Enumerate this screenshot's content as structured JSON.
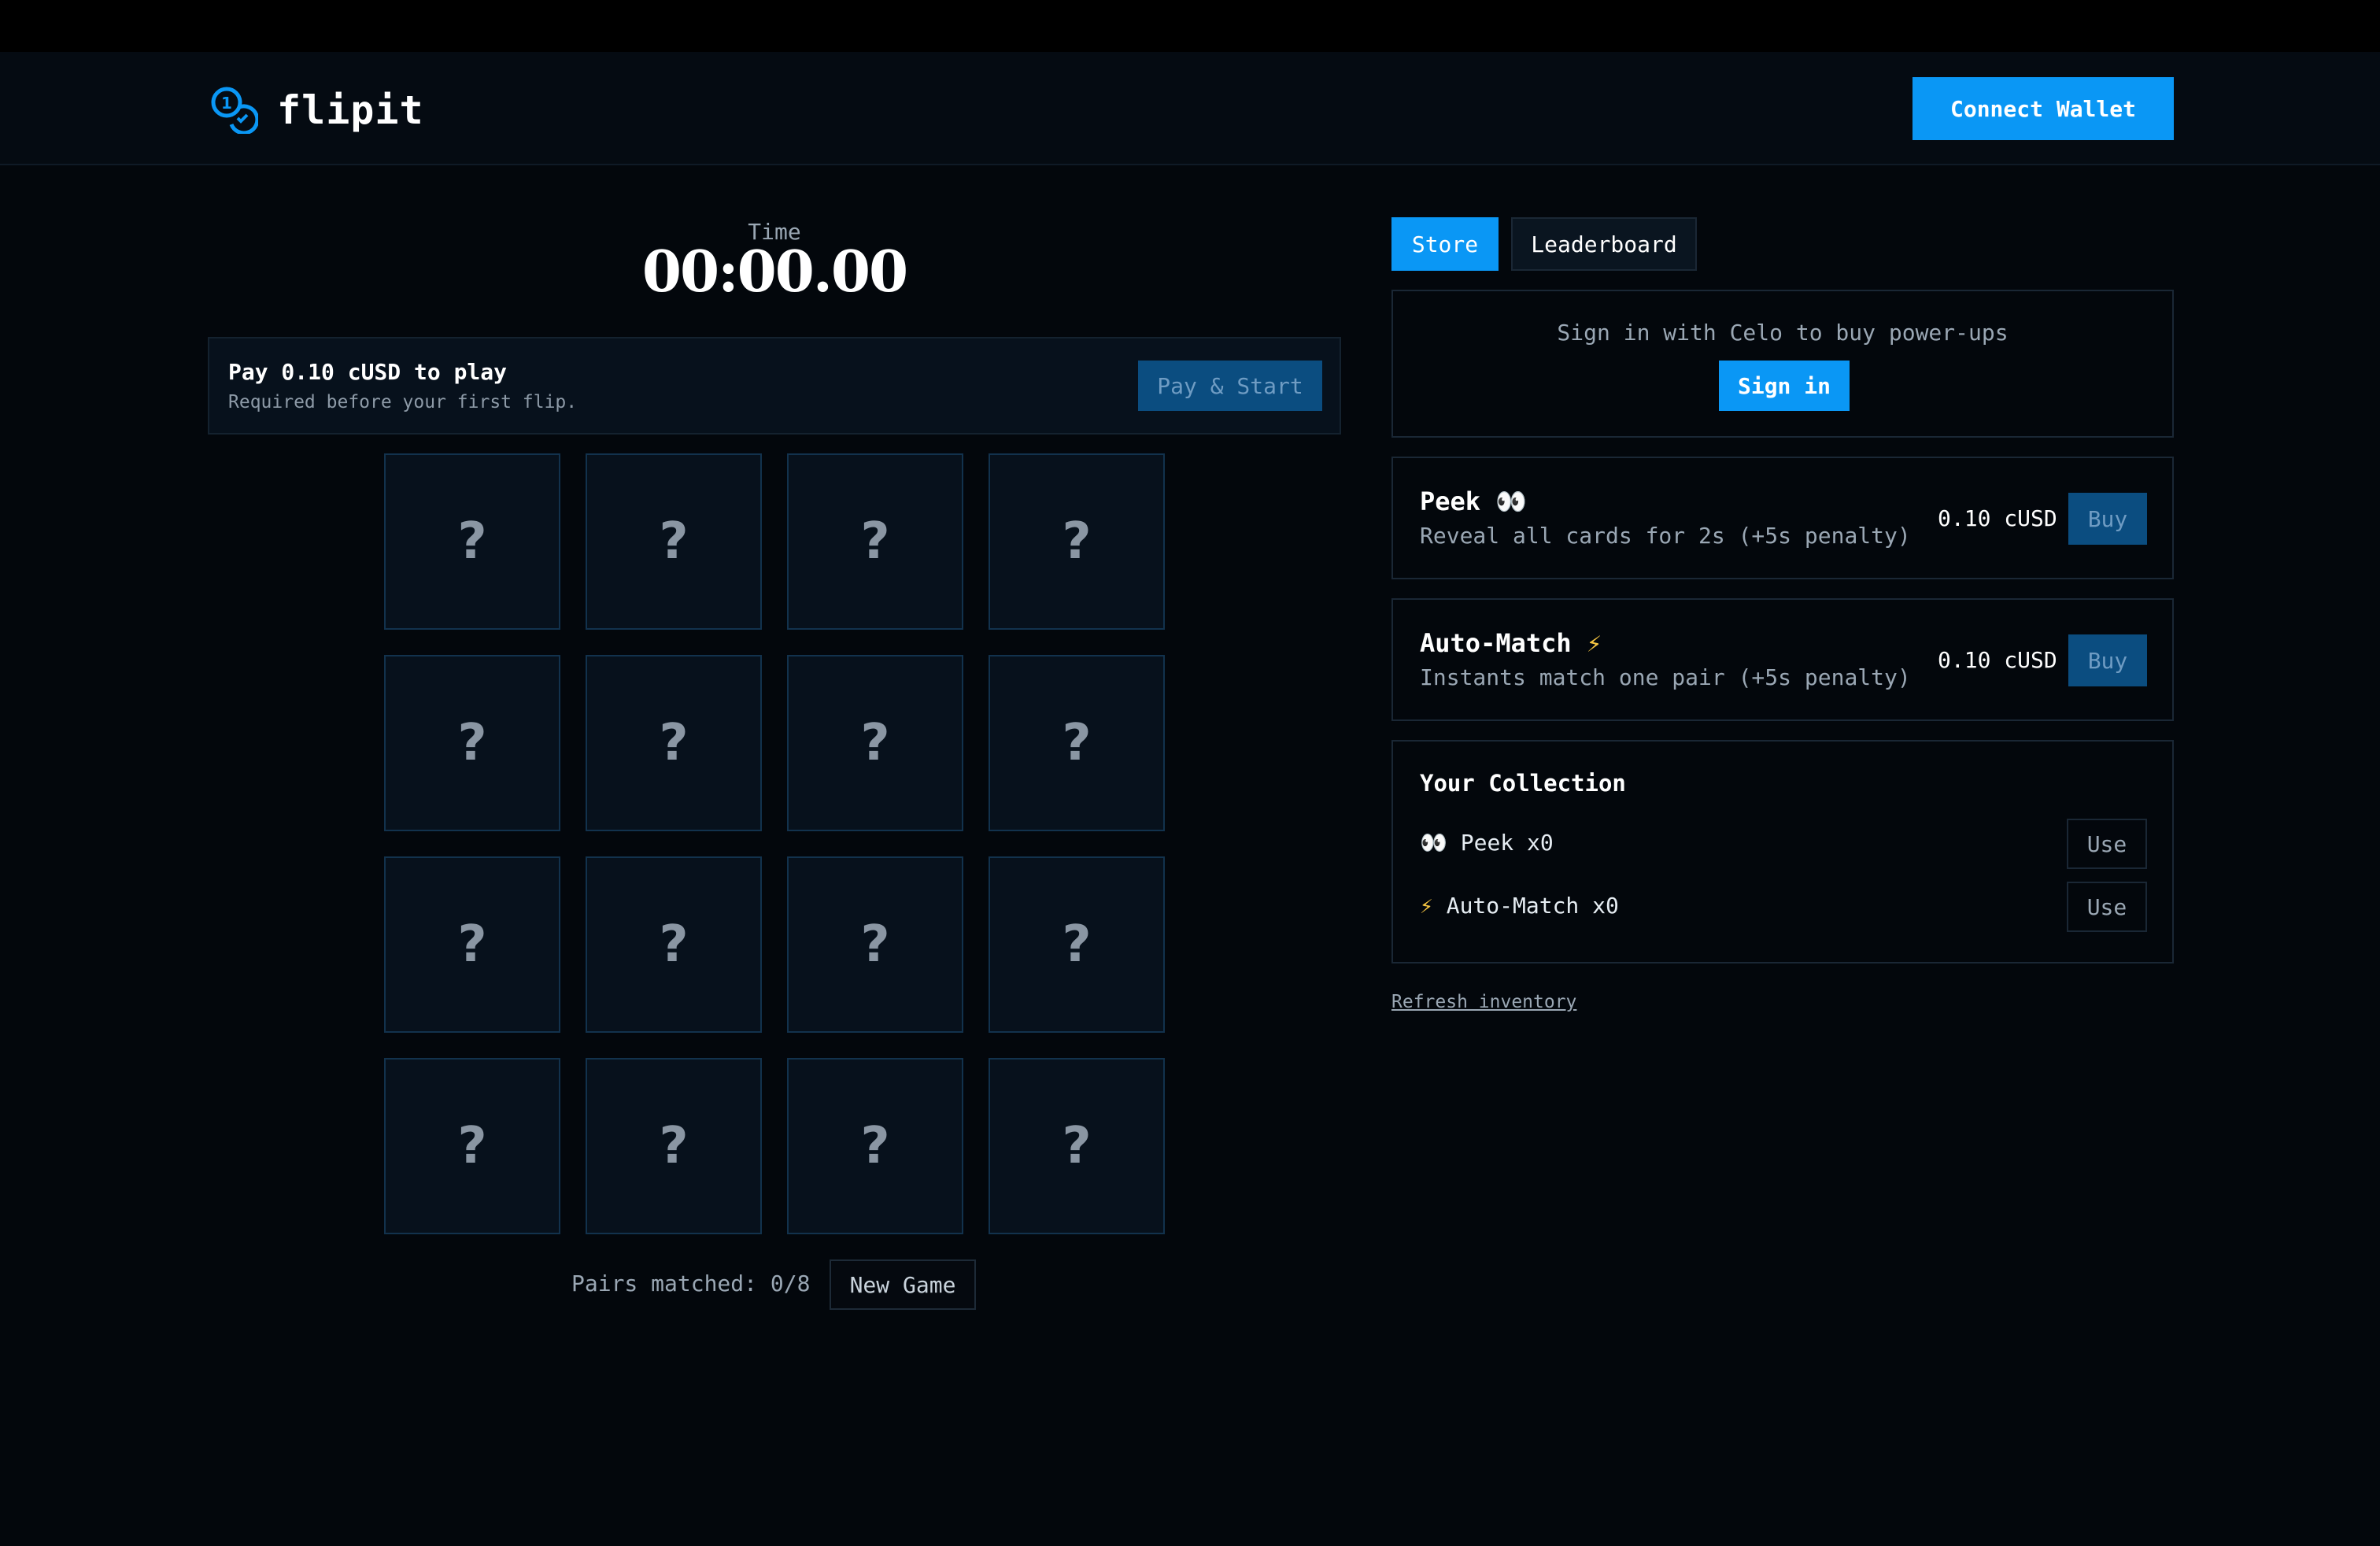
{
  "app": {
    "name": "flipit"
  },
  "header": {
    "connect_label": "Connect Wallet"
  },
  "timer": {
    "label": "Time",
    "value": "00:00.00"
  },
  "pay": {
    "title": "Pay 0.10 cUSD to play",
    "subtitle": "Required before your first flip.",
    "button_label": "Pay & Start"
  },
  "board": {
    "cards": [
      "?",
      "?",
      "?",
      "?",
      "?",
      "?",
      "?",
      "?",
      "?",
      "?",
      "?",
      "?",
      "?",
      "?",
      "?",
      "?"
    ]
  },
  "footer": {
    "pairs_text": "Pairs matched: 0/8",
    "new_game_label": "New Game"
  },
  "tabs": {
    "store": "Store",
    "leaderboard": "Leaderboard"
  },
  "signin": {
    "text": "Sign in with Celo to buy power-ups",
    "button_label": "Sign in"
  },
  "store_items": [
    {
      "title": "Peek",
      "emoji": "👀",
      "desc": "Reveal all cards for 2s (+5s penalty)",
      "price": "0.10 cUSD",
      "button": "Buy"
    },
    {
      "title": "Auto-Match",
      "emoji": "⚡",
      "desc": "Instants match one pair (+5s penalty)",
      "price": "0.10 cUSD",
      "button": "Buy"
    }
  ],
  "collection": {
    "title": "Your Collection",
    "items": [
      {
        "icon": "👀",
        "label": "Peek x0",
        "button": "Use"
      },
      {
        "icon": "⚡",
        "label": "Auto-Match x0",
        "button": "Use"
      }
    ]
  },
  "refresh_label": "Refresh inventory",
  "colors": {
    "accent": "#0a97f5",
    "background": "#03070c",
    "disabled_button": "#0b4d80"
  }
}
